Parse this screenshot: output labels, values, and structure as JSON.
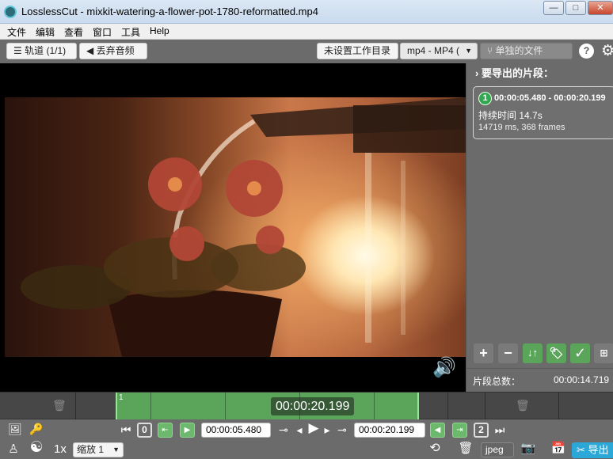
{
  "window": {
    "title": "LosslessCut - mixkit-watering-a-flower-pot-1780-reformatted.mp4",
    "minimize_label": "—",
    "maximize_label": "□",
    "close_label": "✕"
  },
  "menu": {
    "items": [
      "文件",
      "编辑",
      "查看",
      "窗口",
      "工具",
      "Help"
    ]
  },
  "toolbar": {
    "tracks_label": "轨道 (1/1)",
    "discard_audio_label": "丢弃音频",
    "workdir_label": "未设置工作目录",
    "format_label": "mp4 - MP4 (",
    "output_mode_label": "单独的文件",
    "help_label": "?"
  },
  "segments_panel": {
    "title": "要导出的片段：",
    "segment": {
      "index": "1",
      "time_range": "00:00:05.480 - 00:00:20.199",
      "duration": "持续时间 14.7s",
      "frames": "14719 ms, 368 frames"
    },
    "total_label": "片段总数：",
    "total_value": "00:00:14.719"
  },
  "timeline": {
    "segment_marker": "1",
    "current_time": "00:00:20.199"
  },
  "controls": {
    "start_index": "0",
    "cut_start": "00:00:05.480",
    "cut_end": "00:00:20.199",
    "end_index": "2",
    "speed": "1x",
    "zoom_label": "缩放 1",
    "snapshot_format": "jpeg",
    "export_label": "导出"
  },
  "colors": {
    "accent_green": "#5aa55a",
    "panel_gray": "#6b6b6b",
    "export_blue": "#2ba8d8"
  }
}
